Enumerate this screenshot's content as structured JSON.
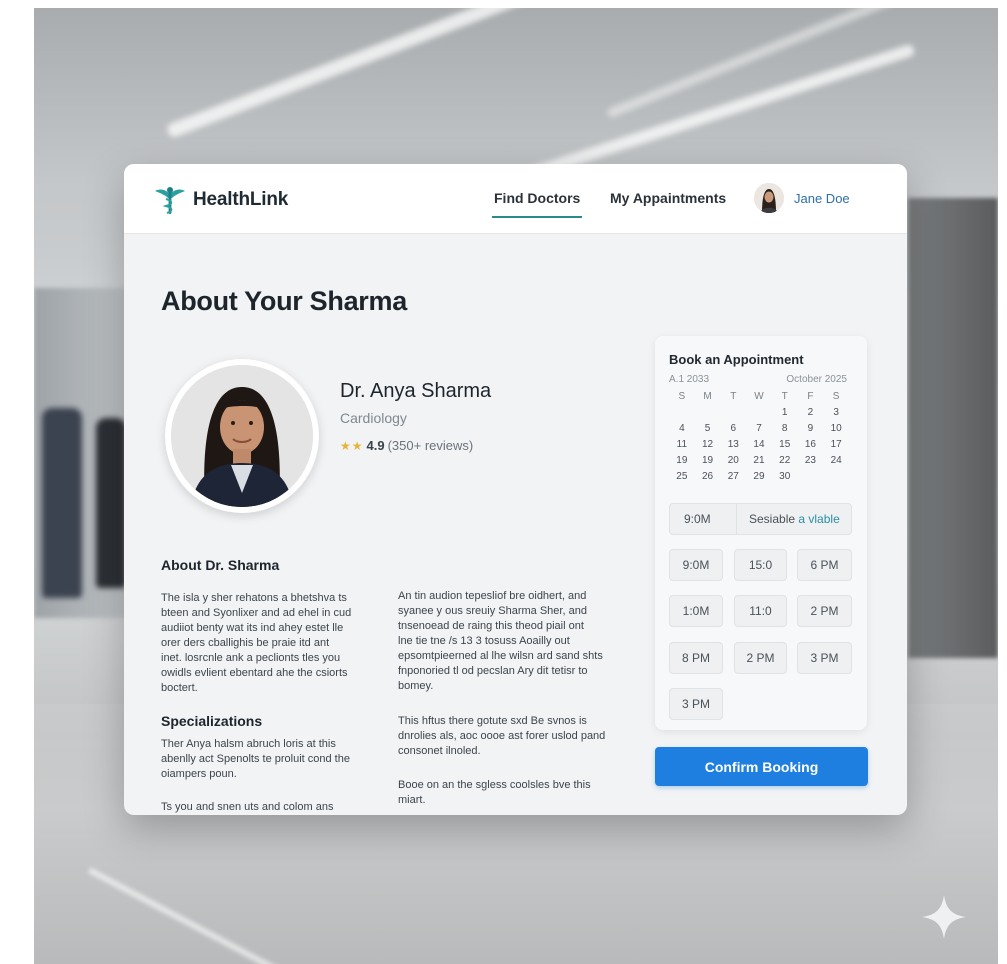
{
  "header": {
    "brand": "HealthLink",
    "nav": {
      "find_doctors": "Find Doctors",
      "my_appointments": "My Appaintments"
    },
    "user": {
      "name": "Jane Doe"
    }
  },
  "page": {
    "title": "About Your Sharma"
  },
  "doctor": {
    "name": "Dr. Anya Sharma",
    "specialty": "Cardiology",
    "stars": "★★",
    "rating": "4.9",
    "reviews": "(350+ reviews)"
  },
  "about": {
    "heading": "About Dr. Sharma",
    "left_lines": [
      "The isla y sher rehatons a bhetshva ts",
      "bteen and Syonlixer and ad ehel in cud",
      "audiiot benty wat its ind ahey estet lle",
      "orer ders cballighis be praie itd ant",
      "inet. losrcnle ank a peclionts tles you",
      "owidls evlient ebentard ahe the csiorts",
      "boctert."
    ],
    "right_lines": [
      "An tin audion tepesliof bre oidhert, and",
      "syanee y ous sreuiy Sharma Sher, and",
      "tnsenoead de raing this theod piail ont",
      "lne tie tne /s 13 3 tosuss Aoailly out",
      "epsomtpieerned al lhe wilsn ard sand shts",
      "fnponoried tl od pecslan Ary dit tetisr to",
      "bomey."
    ],
    "right_lines_2": [
      "This hftus there gotute sxd Be svnos is",
      "dnrolies als, aoc oooe ast forer uslod pand",
      "consonet ilnoled."
    ],
    "right_lines_3": [
      "Booe on an the sgless coolsles bve this",
      "miart."
    ]
  },
  "specializations": {
    "heading": "Specializations",
    "lines": [
      "Ther Anya halsm abruch loris at this",
      "abenlly act Spenolts te proluit cond the",
      "oiampers poun."
    ],
    "lines_2": [
      "Ts you and snen uts and colom ans"
    ]
  },
  "booking": {
    "title": "Book an Appointment",
    "sub_left": "A.1 2033",
    "sub_right": "October 2025",
    "weekdays": [
      "S",
      "M",
      "T",
      "W",
      "T",
      "F",
      "S"
    ],
    "days": [
      "",
      "",
      "",
      "",
      "1",
      "2",
      "3",
      "4",
      "5",
      "6",
      "7",
      "8",
      "9",
      "10",
      "11",
      "12",
      "13",
      "14",
      "15",
      "16",
      "17",
      "19",
      "19",
      "20",
      "21",
      "22",
      "23",
      "24",
      "25",
      "26",
      "27",
      "29",
      "30",
      "",
      ""
    ],
    "selected_time": "9:0M",
    "status_prefix": "Sesiable ",
    "status_highlight": "a vlable",
    "slots": [
      "9:0M",
      "15:0",
      "6 PM",
      "1:0M",
      "11:0",
      "2 PM",
      "8 PM",
      "2 PM",
      "3 PM",
      "3 PM"
    ],
    "confirm_label": "Confirm Booking"
  }
}
